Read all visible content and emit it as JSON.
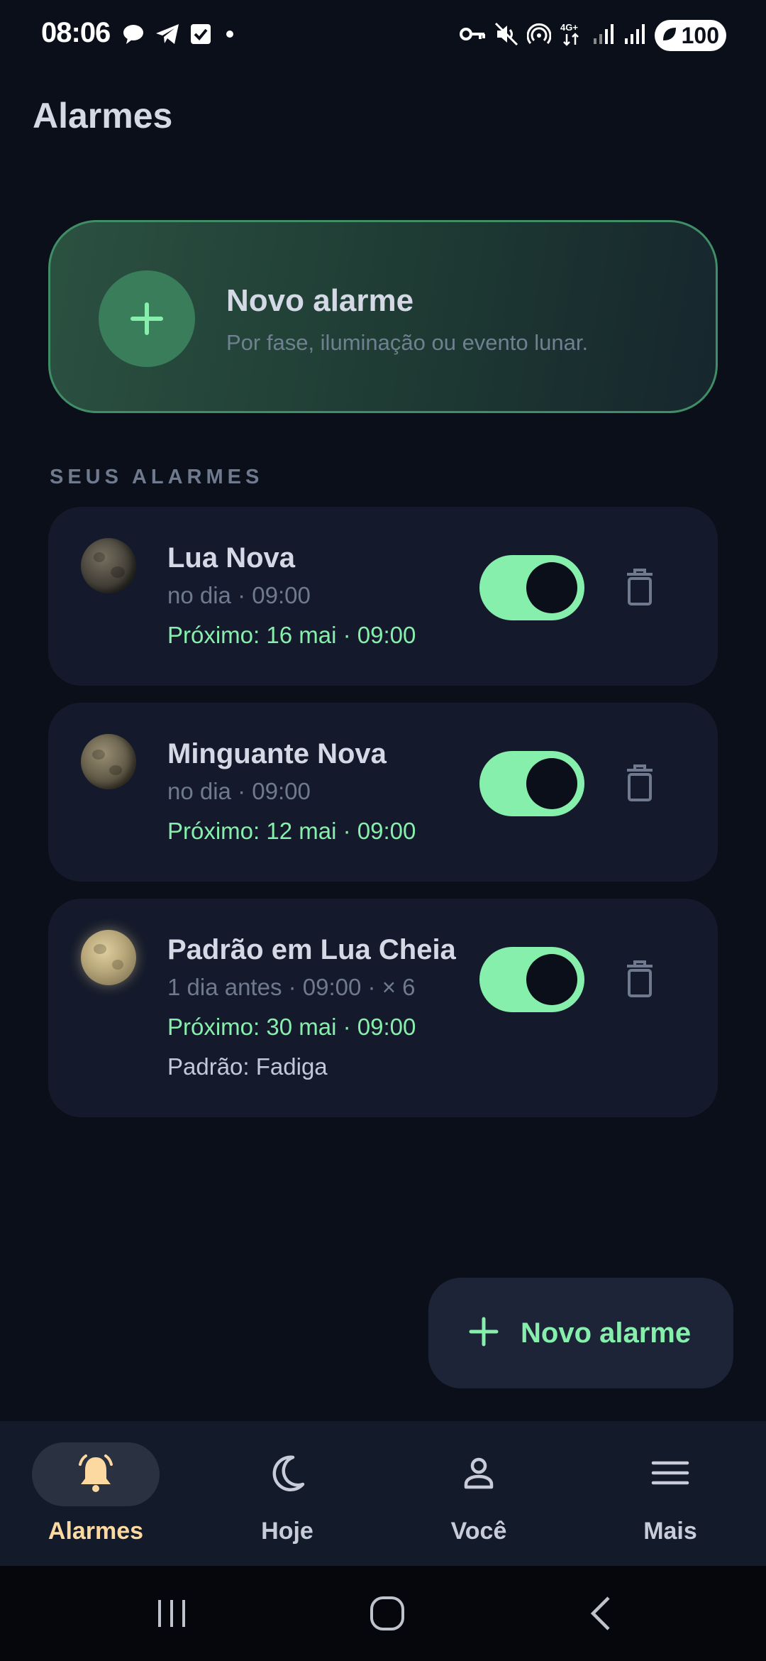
{
  "status_bar": {
    "time": "08:06",
    "battery": "100",
    "left_icons": [
      "chat-bubble-icon",
      "telegram-icon",
      "checkbox-icon",
      "dot-icon"
    ],
    "right_icons": [
      "vpn-key-icon",
      "mute-icon",
      "hotspot-icon",
      "4g-icon",
      "signal-icon",
      "signal-icon",
      "battery-icon"
    ]
  },
  "header": {
    "title": "Alarmes"
  },
  "hero": {
    "title": "Novo alarme",
    "subtitle": "Por fase, iluminação ou evento lunar."
  },
  "section": {
    "label": "SEUS ALARMES"
  },
  "alarms": [
    {
      "title": "Lua Nova",
      "schedule": "no dia · 09:00",
      "next": "Próximo: 16 mai · 09:00",
      "pattern": "",
      "enabled": true,
      "moon": "new-moon-icon"
    },
    {
      "title": "Minguante Nova",
      "schedule": "no dia · 09:00",
      "next": "Próximo: 12 mai · 09:00",
      "pattern": "",
      "enabled": true,
      "moon": "waning-moon-icon"
    },
    {
      "title": "Padrão em Lua Cheia",
      "schedule": "1 dia antes · 09:00 · × 6",
      "next": "Próximo: 30 mai · 09:00",
      "pattern": "Padrão: Fadiga",
      "enabled": true,
      "moon": "full-moon-icon"
    }
  ],
  "fab": {
    "label": "Novo alarme"
  },
  "bottom_nav": {
    "items": [
      {
        "label": "Alarmes",
        "icon": "bell-icon",
        "active": true
      },
      {
        "label": "Hoje",
        "icon": "crescent-moon-icon",
        "active": false
      },
      {
        "label": "Você",
        "icon": "person-icon",
        "active": false
      },
      {
        "label": "Mais",
        "icon": "menu-icon",
        "active": false
      }
    ]
  },
  "colors": {
    "background": "#0b0f19",
    "card": "#141a2b",
    "accent_green": "#86efac",
    "active_nav": "#fcd9a0"
  }
}
